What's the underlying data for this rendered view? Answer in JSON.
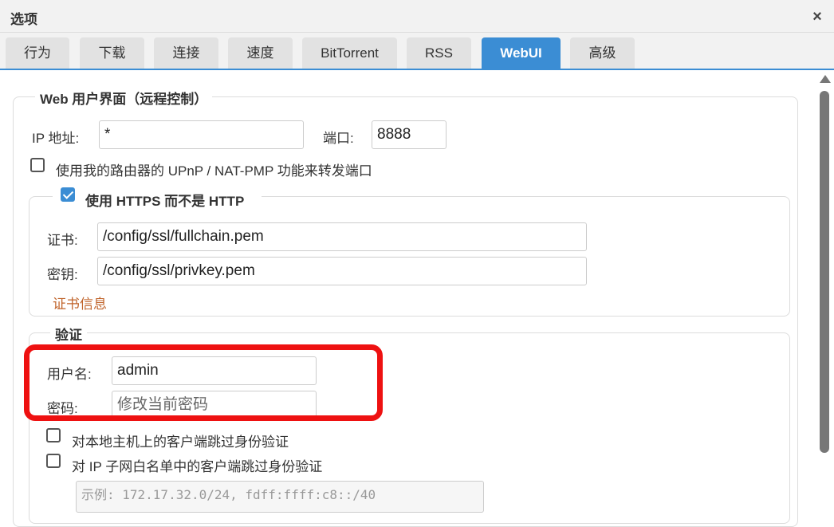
{
  "window": {
    "title": "选项",
    "close_symbol": "×"
  },
  "tabs": [
    {
      "label": "行为",
      "active": false
    },
    {
      "label": "下载",
      "active": false
    },
    {
      "label": "连接",
      "active": false
    },
    {
      "label": "速度",
      "active": false
    },
    {
      "label": "BitTorrent",
      "active": false
    },
    {
      "label": "RSS",
      "active": false
    },
    {
      "label": "WebUI",
      "active": true
    },
    {
      "label": "高级",
      "active": false
    }
  ],
  "webui": {
    "legend": "Web 用户界面（远程控制）",
    "ip_label": "IP 地址:",
    "ip_value": "*",
    "port_label": "端口:",
    "port_value": "8888",
    "upnp_label": "使用我的路由器的 UPnP / NAT-PMP 功能来转发端口",
    "upnp_checked": false
  },
  "https": {
    "legend": "使用 HTTPS 而不是 HTTP",
    "checked": true,
    "cert_label": "证书:",
    "cert_value": "/config/ssl/fullchain.pem",
    "key_label": "密钥:",
    "key_value": "/config/ssl/privkey.pem",
    "info_link": "证书信息"
  },
  "auth": {
    "legend": "验证",
    "username_label": "用户名:",
    "username_value": "admin",
    "password_label": "密码:",
    "password_placeholder": "修改当前密码",
    "bypass_local_label": "对本地主机上的客户端跳过身份验证",
    "bypass_local_checked": false,
    "bypass_whitelist_label": "对 IP 子网白名单中的客户端跳过身份验证",
    "bypass_whitelist_checked": false,
    "whitelist_placeholder": "示例: 172.17.32.0/24, fdff:ffff:c8::/40"
  },
  "accent_color": "#3b8dd4",
  "highlight_color": "#ee1111"
}
